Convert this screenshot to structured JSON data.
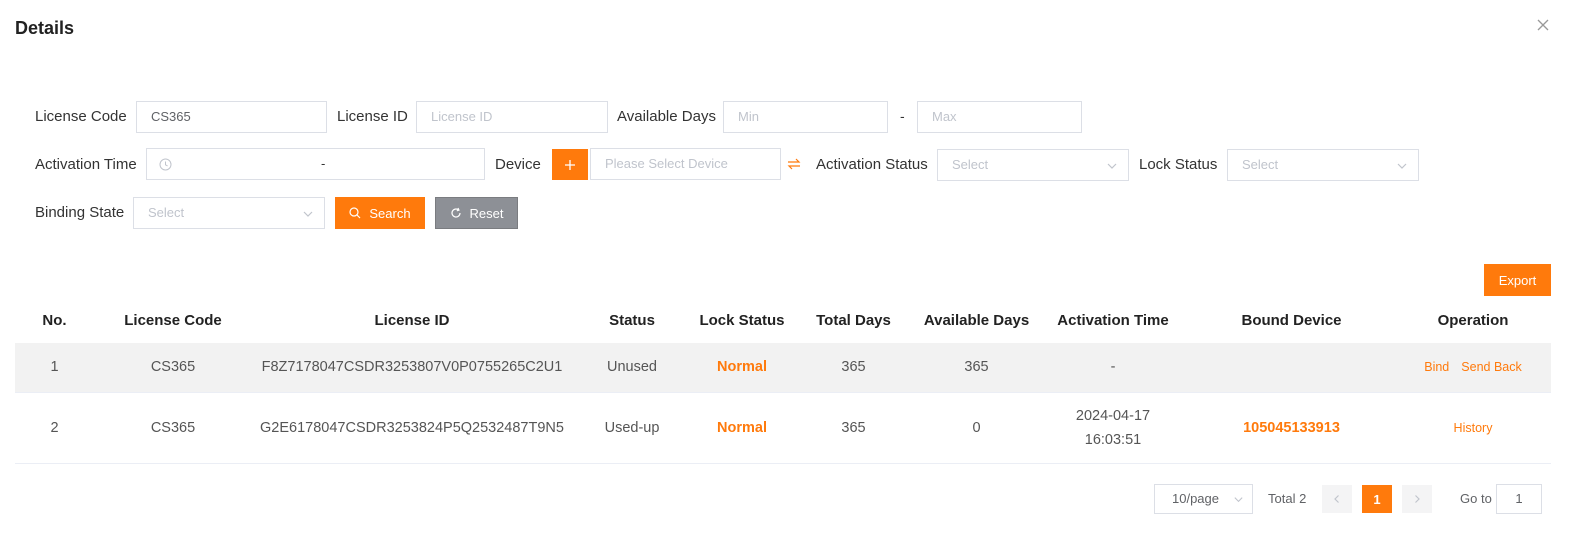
{
  "dialog": {
    "title": "Details"
  },
  "filters": {
    "license_code": {
      "label": "License Code",
      "value": "CS365"
    },
    "license_id": {
      "label": "License ID",
      "placeholder": "License ID"
    },
    "available_days": {
      "label": "Available Days",
      "min_placeholder": "Min",
      "separator": "-",
      "max_placeholder": "Max"
    },
    "activation_time": {
      "label": "Activation Time",
      "separator": "-"
    },
    "device": {
      "label": "Device",
      "placeholder": "Please Select Device"
    },
    "activation_status": {
      "label": "Activation Status",
      "placeholder": "Select"
    },
    "lock_status": {
      "label": "Lock Status",
      "placeholder": "Select"
    },
    "binding_state": {
      "label": "Binding State",
      "placeholder": "Select"
    },
    "search_label": "Search",
    "reset_label": "Reset"
  },
  "toolbar": {
    "export_label": "Export"
  },
  "table": {
    "columns": [
      "No.",
      "License Code",
      "License ID",
      "Status",
      "Lock Status",
      "Total Days",
      "Available Days",
      "Activation Time",
      "Bound Device",
      "Operation"
    ],
    "rows": [
      {
        "no": "1",
        "code": "CS365",
        "id": "F8Z7178047CSDR3253807V0P0755265C2U1",
        "status": "Unused",
        "lock": "Normal",
        "total": "365",
        "available": "365",
        "time_date": "-",
        "time_clock": "",
        "device": "",
        "ops": [
          "Bind",
          "Send Back"
        ]
      },
      {
        "no": "2",
        "code": "CS365",
        "id": "G2E6178047CSDR3253824P5Q2532487T9N5",
        "status": "Used-up",
        "lock": "Normal",
        "total": "365",
        "available": "0",
        "time_date": "2024-04-17",
        "time_clock": "16:03:51",
        "device": "105045133913",
        "ops": [
          "History"
        ]
      }
    ]
  },
  "pagination": {
    "page_size": "10/page",
    "total": "Total 2",
    "current_page": "1",
    "goto_label": "Go to",
    "goto_value": "1"
  },
  "colors": {
    "accent": "#ff7a0c",
    "reset_button": "#8d9096",
    "row_highlight": "#f2f2f2"
  }
}
